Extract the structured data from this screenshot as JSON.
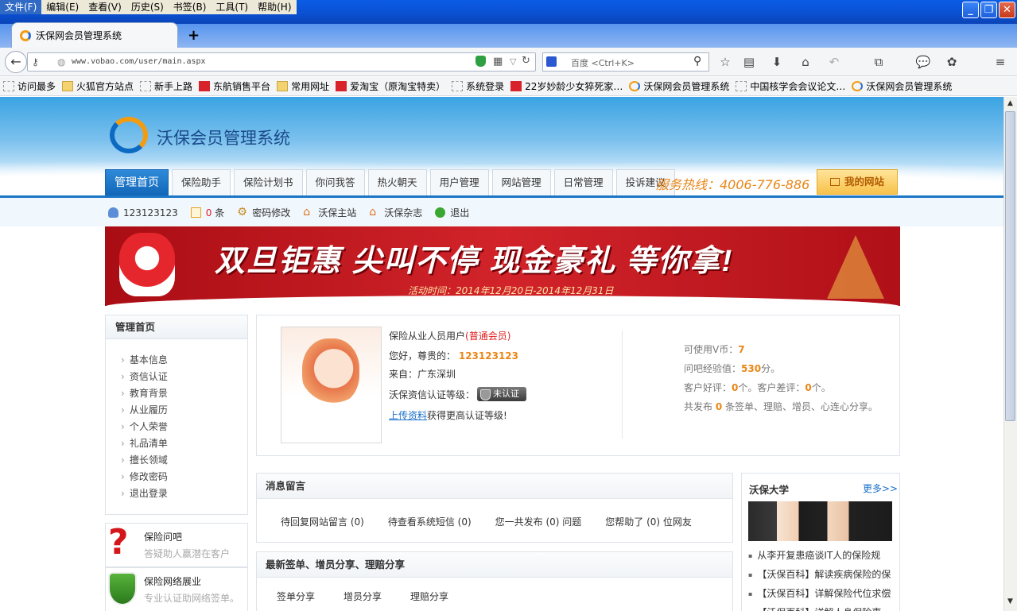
{
  "browser": {
    "menu": [
      "文件(F)",
      "编辑(E)",
      "查看(V)",
      "历史(S)",
      "书签(B)",
      "工具(T)",
      "帮助(H)"
    ],
    "tab_title": "沃保网会员管理系统",
    "new_tab": "+",
    "url": "www.vobao.com/user/main.aspx",
    "search_placeholder": "百度 <Ctrl+K>",
    "bookmarks": [
      {
        "label": "访问最多",
        "icon": "page"
      },
      {
        "label": "火狐官方站点",
        "icon": "folder"
      },
      {
        "label": "新手上路",
        "icon": "page"
      },
      {
        "label": "东航销售平台",
        "icon": "red"
      },
      {
        "label": "常用网址",
        "icon": "folder"
      },
      {
        "label": "爱淘宝（原淘宝特卖）",
        "icon": "red"
      },
      {
        "label": "系统登录",
        "icon": "page"
      },
      {
        "label": "22岁妙龄少女猝死家…",
        "icon": "red"
      },
      {
        "label": "沃保网会员管理系统",
        "icon": "ffi"
      },
      {
        "label": "中国核学会会议论文…",
        "icon": "page"
      },
      {
        "label": "沃保网会员管理系统",
        "icon": "ffi"
      }
    ]
  },
  "site": {
    "name": "沃保会员管理系统",
    "nav": [
      "管理首页",
      "保险助手",
      "保险计划书",
      "你问我答",
      "热火朝天",
      "用户管理",
      "网站管理",
      "日常管理",
      "投诉建议"
    ],
    "hotline": "服务热线：4006-776-886",
    "my_site": "我的网站"
  },
  "userbar": {
    "username": "123123123",
    "msg_count": "0",
    "msg_unit": "条",
    "password": "密码修改",
    "home": "沃保主站",
    "magazine": "沃保杂志",
    "logout": "退出"
  },
  "banner": {
    "title": "双旦钜惠 尖叫不停 现金豪礼 等你拿!",
    "subtitle": "活动时间：2014年12月20日-2014年12月31日"
  },
  "sidebar": {
    "title": "管理首页",
    "items": [
      "基本信息",
      "资信认证",
      "教育背景",
      "从业履历",
      "个人荣誉",
      "礼品清单",
      "擅长领域",
      "修改密码",
      "退出登录"
    ],
    "promo1": {
      "title": "保险问吧",
      "sub": "答疑助人赢潜在客户"
    },
    "promo2": {
      "title": "保险网络展业",
      "sub": "专业认证助网络签单。"
    }
  },
  "profile": {
    "role": "保险从业人员用户",
    "level": "(普通会员)",
    "greeting": "您好，尊贵的：",
    "name": "123123123",
    "from_label": "来自：",
    "from": "广东深圳",
    "cert_label": "沃保资信认证等级：",
    "cert_status": "未认证",
    "upload_link": "上传资料",
    "upload_tail": "获得更高认证等级!",
    "vcoin_label": "可使用V币：",
    "vcoin": "7",
    "exp_label": "问吧经验值：",
    "exp": "530",
    "exp_unit": "分。",
    "good_label": "客户好评：",
    "good": "0",
    "good_unit": "个。客户差评：",
    "bad": "0",
    "bad_unit": "个。",
    "post_label": "共发布",
    "post": "0",
    "post_tail": "条签单、理赔、增员、心连心分享。"
  },
  "messages": {
    "title": "消息留言",
    "items": [
      "待回复网站留言 (0)",
      "待查看系统短信 (0)",
      "您一共发布 (0) 问题",
      "您帮助了 (0) 位网友"
    ]
  },
  "share": {
    "title": "最新签单、增员分享、理赔分享",
    "tabs": [
      "签单分享",
      "增员分享",
      "理赔分享"
    ]
  },
  "university": {
    "title": "沃保大学",
    "more": "更多>>",
    "items": [
      "从李开复患癌谈IT人的保险规",
      "【沃保百科】解读疾病保险的保",
      "【沃保百科】详解保险代位求偿",
      "【沃保百科】详解人身保险事"
    ]
  }
}
